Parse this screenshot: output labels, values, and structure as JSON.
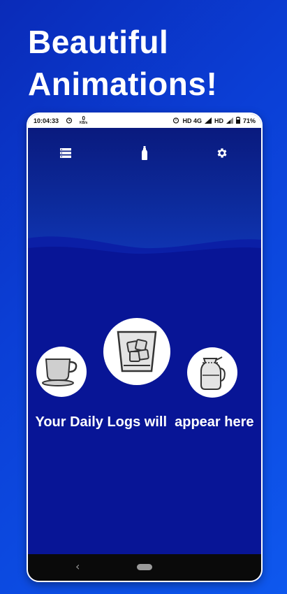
{
  "promo": {
    "line1": "Beautiful",
    "line2": "Animations!"
  },
  "status_bar": {
    "time": "10:04:33",
    "net_speed_value": "0",
    "net_speed_unit": "KB/s",
    "network_label": "HD 4G",
    "network_label_2": "HD",
    "battery": "71%"
  },
  "toolbar": {
    "left_icon": "list-icon",
    "center_icon": "bottle-icon",
    "right_icon": "gear-icon"
  },
  "drinks": [
    {
      "icon": "coffee-cup-icon"
    },
    {
      "icon": "ice-glass-icon"
    },
    {
      "icon": "water-jug-icon"
    }
  ],
  "empty_state": {
    "message": "Your Daily Logs will  appear here"
  },
  "nav": {
    "back": "‹"
  },
  "colors": {
    "promo_bg": "#0b3fd6",
    "app_bg": "#081596",
    "header_bg": "#0c2a9b",
    "text": "#ffffff"
  }
}
